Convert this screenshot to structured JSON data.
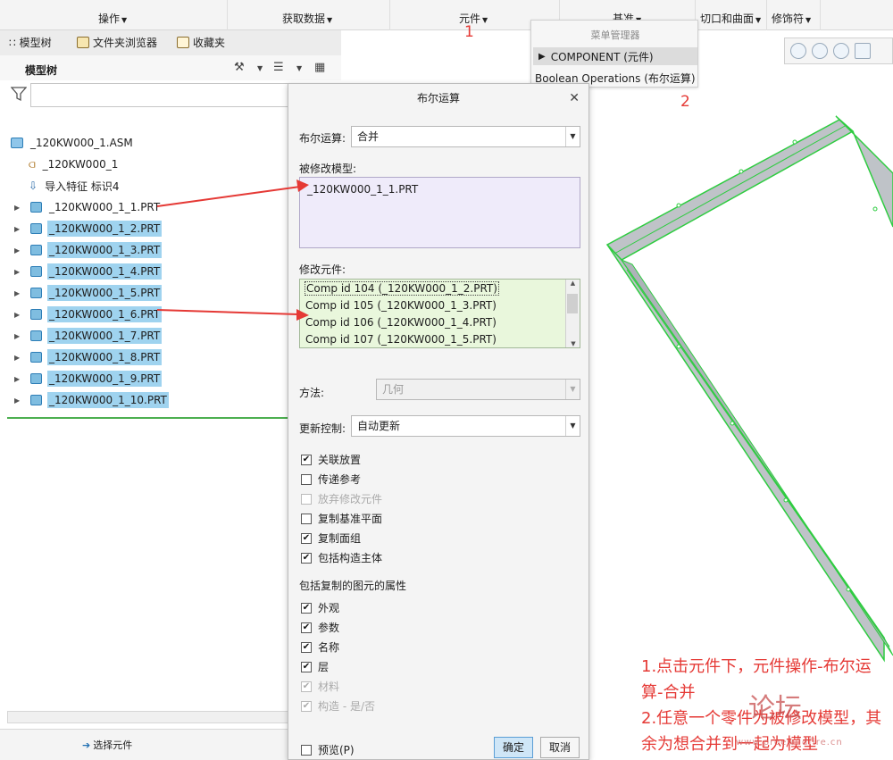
{
  "ribbon": {
    "items": [
      "操作",
      "获取数据",
      "元件",
      "基准",
      "切口和曲面",
      "修饰符"
    ]
  },
  "left_tabs": {
    "model_tree": "模型树",
    "folder_browser": "文件夹浏览器",
    "favorites": "收藏夹"
  },
  "tree": {
    "header": "模型树",
    "root": "_120KW000_1.ASM",
    "csys": "_120KW000_1",
    "import_feature": "导入特征 标识4",
    "parts": [
      {
        "label": "_120KW000_1_1.PRT",
        "selected": false
      },
      {
        "label": "_120KW000_1_2.PRT",
        "selected": true
      },
      {
        "label": "_120KW000_1_3.PRT",
        "selected": true
      },
      {
        "label": "_120KW000_1_4.PRT",
        "selected": true
      },
      {
        "label": "_120KW000_1_5.PRT",
        "selected": true
      },
      {
        "label": "_120KW000_1_6.PRT",
        "selected": true
      },
      {
        "label": "_120KW000_1_7.PRT",
        "selected": true
      },
      {
        "label": "_120KW000_1_8.PRT",
        "selected": true
      },
      {
        "label": "_120KW000_1_9.PRT",
        "selected": true
      },
      {
        "label": "_120KW000_1_10.PRT",
        "selected": true
      }
    ],
    "select_component": "选择元件"
  },
  "menu_manager": {
    "title": "菜单管理器",
    "item1": "COMPONENT (元件)",
    "item2": "Boolean Operations (布尔运算)"
  },
  "dialog": {
    "title": "布尔运算",
    "bool_label": "布尔运算:",
    "bool_value": "合并",
    "modified_model_label": "被修改模型:",
    "modified_model_value": "_120KW000_1_1.PRT",
    "modifying_comps_label": "修改元件:",
    "modifying_comps": [
      "Comp id 104 (_120KW000_1_2.PRT)",
      "Comp id 105 (_120KW000_1_3.PRT)",
      "Comp id 106 (_120KW000_1_4.PRT)",
      "Comp id 107 (_120KW000_1_5.PRT)"
    ],
    "method_label": "方法:",
    "method_value": "几何",
    "update_label": "更新控制:",
    "update_value": "自动更新",
    "options": [
      {
        "label": "关联放置",
        "checked": true,
        "enabled": true
      },
      {
        "label": "传递参考",
        "checked": false,
        "enabled": true
      },
      {
        "label": "放弃修改元件",
        "checked": false,
        "enabled": false
      },
      {
        "label": "复制基准平面",
        "checked": false,
        "enabled": true
      },
      {
        "label": "复制面组",
        "checked": true,
        "enabled": true
      },
      {
        "label": "包括构造主体",
        "checked": true,
        "enabled": true
      }
    ],
    "attrs_label": "包括复制的图元的属性",
    "attrs": [
      {
        "label": "外观",
        "checked": true,
        "enabled": true
      },
      {
        "label": "参数",
        "checked": true,
        "enabled": true
      },
      {
        "label": "名称",
        "checked": true,
        "enabled": true
      },
      {
        "label": "层",
        "checked": true,
        "enabled": true
      },
      {
        "label": "材料",
        "checked": true,
        "enabled": false
      },
      {
        "label": "构造 - 是/否",
        "checked": true,
        "enabled": false
      }
    ],
    "preview_label": "预览(P)",
    "ok": "确定",
    "cancel": "取消"
  },
  "annotations": {
    "num1": "1",
    "num2": "2",
    "line1": "1.点击元件下，元件操作-布尔运算-合并",
    "line2": "2.任意一个零件为被修改模型，其余为想合并到一起为模型"
  },
  "watermark": {
    "text": "论坛",
    "url": "www.proewildfire.cn"
  },
  "colors": {
    "selection": "#9fd3ef",
    "annotation": "#e53935",
    "model_edge": "#2ecc40",
    "model_face": "#b9bec4"
  }
}
